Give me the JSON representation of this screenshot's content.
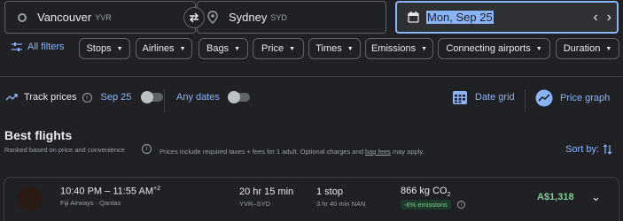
{
  "search": {
    "from_city": "Vancouver",
    "from_code": "YVR",
    "to_city": "Sydney",
    "to_code": "SYD",
    "date": "Mon, Sep 25"
  },
  "filters": {
    "all_filters": "All filters",
    "chips": [
      "Stops",
      "Airlines",
      "Bags",
      "Price",
      "Times",
      "Emissions",
      "Connecting airports",
      "Duration"
    ]
  },
  "track": {
    "label": "Track prices",
    "date": "Sep 25",
    "any_dates": "Any dates",
    "date_grid": "Date grid",
    "price_graph": "Price graph"
  },
  "results": {
    "title": "Best flights",
    "ranked": "Ranked based on price and convenience",
    "prices_note_prefix": "Prices include required taxes + fees for 1 adult. Optional charges and",
    "bag_fees": "bag fees",
    "prices_note_suffix": "may apply.",
    "sort_by": "Sort by:"
  },
  "flight": {
    "depart": "10:40 PM",
    "arrive": "11:55 AM",
    "day_offset": "+2",
    "airlines": "Fiji Airways · Qantas",
    "duration": "20 hr 15 min",
    "route": "YVR–SYD",
    "stops": "1 stop",
    "layover": "3 hr 40 min NAN",
    "emissions_value": "866 kg CO",
    "emissions_sub": "2",
    "emissions_badge": "-6% emissions",
    "price": "A$1,318"
  },
  "colors": {
    "accent": "#8ab4f8",
    "price_green": "#81c995",
    "background": "#202124"
  }
}
